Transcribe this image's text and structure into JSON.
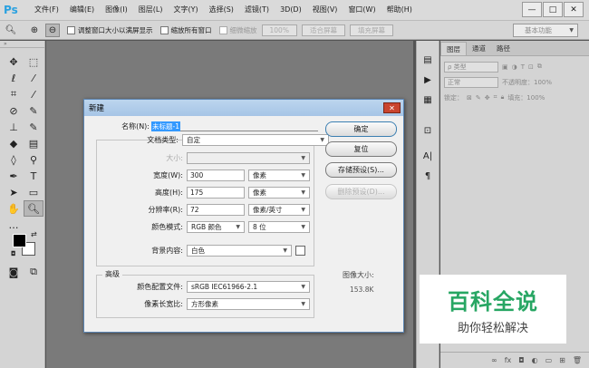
{
  "app": {
    "logo": "Ps"
  },
  "menubar": {
    "items": [
      "文件(F)",
      "编辑(E)",
      "图像(I)",
      "图层(L)",
      "文字(Y)",
      "选择(S)",
      "滤镜(T)",
      "3D(D)",
      "视图(V)",
      "窗口(W)",
      "帮助(H)"
    ],
    "controls": [
      "—",
      "□",
      "✕"
    ]
  },
  "options_bar": {
    "resize_windows_label": "调整窗口大小以满屏显示",
    "zoom_all_label": "缩放所有窗口",
    "scrubby_label": "细微缩放",
    "zoom_value": "100%",
    "fit_screen": "适合屏幕",
    "fill_screen": "填充屏幕",
    "workspace": "基本功能"
  },
  "layers_panel": {
    "tabs": [
      "图层",
      "通道",
      "路径"
    ],
    "kind_label": "ρ 类型",
    "blend_mode": "正常",
    "opacity_label": "不透明度：100%",
    "lock_label": "锁定：",
    "fill_label": "填充：100%"
  },
  "dialog": {
    "title": "新建",
    "close": "✕",
    "name_label": "名称(N):",
    "name_value": "未标题-1",
    "preset_label": "文档类型:",
    "preset_value": "自定",
    "size_label": "大小:",
    "width_label": "宽度(W):",
    "width_value": "300",
    "width_unit": "像素",
    "height_label": "高度(H):",
    "height_value": "175",
    "height_unit": "像素",
    "resolution_label": "分辨率(R):",
    "resolution_value": "72",
    "resolution_unit": "像素/英寸",
    "color_mode_label": "颜色模式:",
    "color_mode_value": "RGB 颜色",
    "bit_depth_value": "8 位",
    "background_label": "背景内容:",
    "background_value": "白色",
    "advanced_label": "高级",
    "profile_label": "颜色配置文件:",
    "profile_value": "sRGB IEC61966-2.1",
    "pixel_aspect_label": "像素长宽比:",
    "pixel_aspect_value": "方形像素",
    "ok_button": "确定",
    "reset_button": "复位",
    "save_preset_button": "存储预设(S)...",
    "delete_preset_button": "删除预设(D)...",
    "image_size_label": "图像大小:",
    "image_size_value": "153.8K"
  },
  "watermark": {
    "title": "百科全说",
    "subtitle": "助你轻松解决"
  },
  "colors": {
    "menubar": "#dadada",
    "canvas": "#7a7a7a",
    "dialog_title": "#a6c5e6",
    "watermark_green": "#27a663"
  }
}
